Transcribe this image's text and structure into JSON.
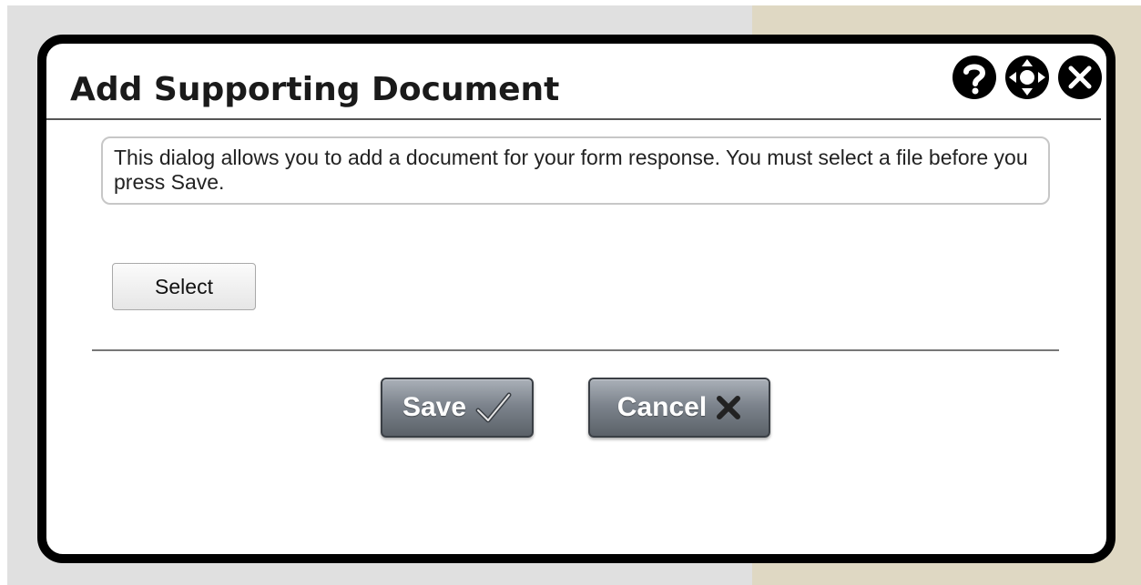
{
  "dialog": {
    "title": "Add Supporting Document",
    "header_icons": [
      "help-icon",
      "move-icon",
      "close-icon"
    ],
    "info_text": "This dialog allows you to add a document for your form response. You must select a file before you press Save.",
    "select_label": "Select",
    "save_label": "Save",
    "save_icon": "checkmark-icon",
    "cancel_label": "Cancel",
    "cancel_icon": "x-icon"
  },
  "colors": {
    "background_left": "#e0e0e0",
    "background_right": "#dfd8c3",
    "dialog_border": "#000000",
    "button_gradient_top": "#aab0b8",
    "button_gradient_bottom": "#5b6168"
  }
}
